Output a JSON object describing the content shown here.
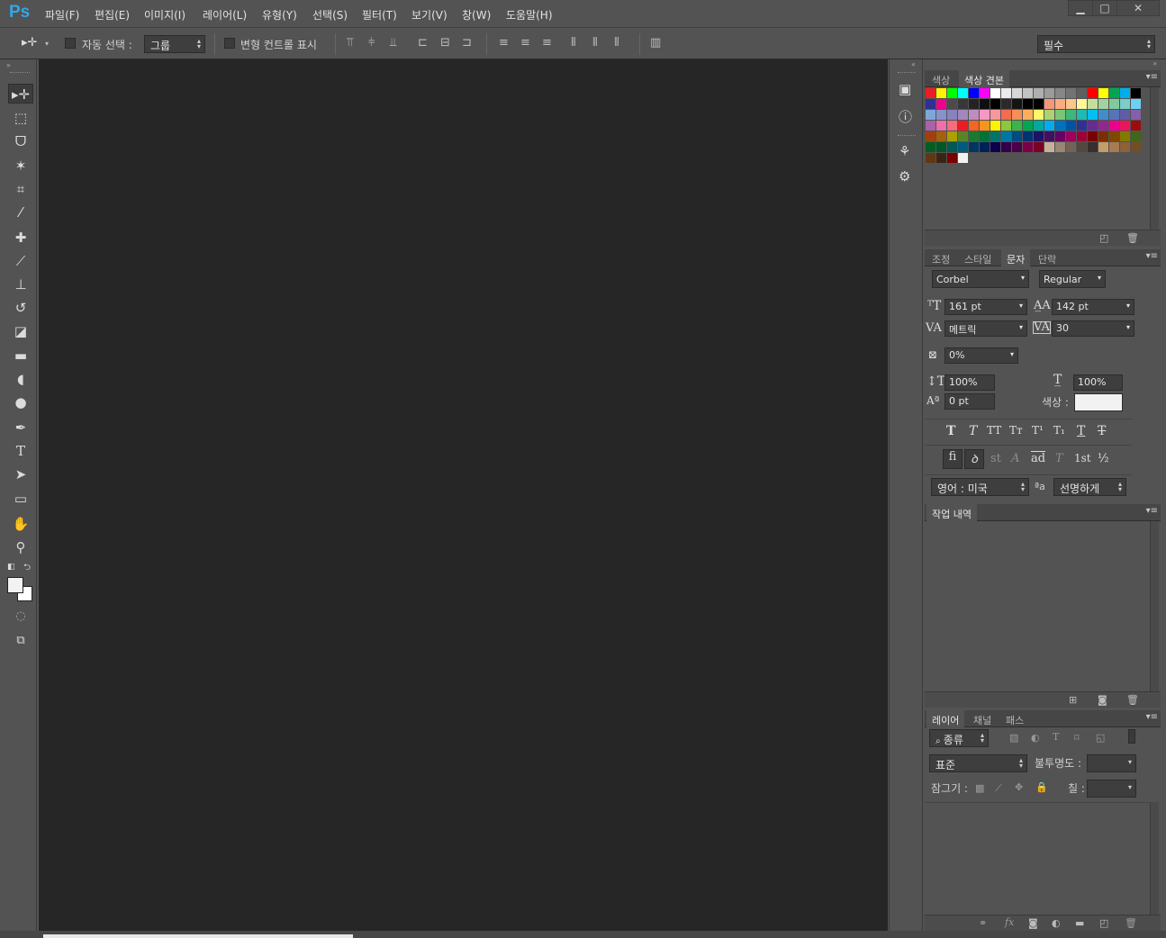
{
  "app": {
    "logo": "Ps"
  },
  "menu": [
    "파일(F)",
    "편집(E)",
    "이미지(I)",
    "레이어(L)",
    "유형(Y)",
    "선택(S)",
    "필터(T)",
    "보기(V)",
    "창(W)",
    "도움말(H)"
  ],
  "window_controls": {
    "minimize": "▁",
    "maximize": "□",
    "close": "✕"
  },
  "options_bar": {
    "auto_select_label": "자동 선택 :",
    "auto_select_value": "그룹",
    "transform_controls_label": "변형 컨트롤 표시",
    "workspace": "필수"
  },
  "swatches": {
    "tabs": [
      "색상",
      "색상 견본"
    ],
    "colors": [
      "#ec1c24",
      "#fff200",
      "#00ff00",
      "#00ffff",
      "#0000ff",
      "#ff00ff",
      "#ffffff",
      "#ebebeb",
      "#d7d7d7",
      "#c3c3c3",
      "#afafaf",
      "#9b9b9b",
      "#878787",
      "#737373",
      "#5f5f5f",
      "#ff0000",
      "#ffff00",
      "#00a651",
      "#00aeef",
      "#000000",
      "#2e3192",
      "#ec008c",
      "#4b4b4b",
      "#373737",
      "#232323",
      "#0f0f0f",
      "#000000",
      "#2a2a2a",
      "#141414",
      "#000000",
      "#000000",
      "#f7977a",
      "#f9ad81",
      "#fdc68a",
      "#fff79a",
      "#c4df9b",
      "#a3d39c",
      "#82ca9d",
      "#7bcdc8",
      "#6ecff6",
      "#7ea7d8",
      "#8493ca",
      "#8882be",
      "#a187be",
      "#bc8dbf",
      "#f49ac2",
      "#f6989d",
      "#f26c4f",
      "#f68e56",
      "#fbaf5d",
      "#fff568",
      "#acd373",
      "#7cc576",
      "#3cb878",
      "#1cbbb4",
      "#00bff3",
      "#438ccb",
      "#5574b9",
      "#605ca8",
      "#855fa8",
      "#a863a8",
      "#f06ea9",
      "#f26d7d",
      "#ed1c24",
      "#f26522",
      "#f7941d",
      "#fff200",
      "#8dc63f",
      "#39b54a",
      "#00a651",
      "#00a99d",
      "#00aeef",
      "#0072bc",
      "#0054a6",
      "#2e3192",
      "#662d91",
      "#92278f",
      "#ec008c",
      "#ed145b",
      "#9e0b0f",
      "#a0410d",
      "#a36209",
      "#aba000",
      "#598527",
      "#1a7b30",
      "#007236",
      "#00746b",
      "#0076a3",
      "#004b80",
      "#003471",
      "#1b1464",
      "#440e62",
      "#630460",
      "#9e005d",
      "#9e0039",
      "#790000",
      "#7b2e00",
      "#7d4900",
      "#827b00",
      "#406618",
      "#005e20",
      "#005826",
      "#005952",
      "#005b7f",
      "#003663",
      "#002157",
      "#0d004c",
      "#32004b",
      "#4b0049",
      "#7b0046",
      "#7a0026",
      "#c7b299",
      "#998675",
      "#736357",
      "#534741",
      "#362f2d",
      "#c69c6d",
      "#a67c52",
      "#8c6239",
      "#754c24",
      "#603913",
      "#3c2415",
      "#790000",
      "#f2f2f2"
    ]
  },
  "character": {
    "tabs": [
      "조정",
      "스타일",
      "문자",
      "단락"
    ],
    "font_family": "Corbel",
    "font_style": "Regular",
    "size": "161 pt",
    "leading": "142 pt",
    "kerning": "메트릭",
    "tracking": "30",
    "tsume": "0%",
    "vertical_scale": "100%",
    "horizontal_scale": "100%",
    "baseline_shift": "0 pt",
    "color_label": "색상 :",
    "color_value": "#f2f2f2",
    "style_buttons": [
      "T",
      "T",
      "TT",
      "Tт",
      "T¹",
      "T₁",
      "T",
      "T"
    ],
    "opentype_buttons": [
      "fi",
      "ꝺ",
      "st",
      "A",
      "ad",
      "T",
      "1st",
      "½"
    ],
    "language": "영어 : 미국",
    "aa_icon": "ªa",
    "antialias": "선명하게"
  },
  "history": {
    "tabs": [
      "작업 내역"
    ]
  },
  "layers": {
    "tabs": [
      "레이어",
      "채널",
      "패스"
    ],
    "filter_kind": "종류",
    "blend_mode": "표준",
    "opacity_label": "불투명도 :",
    "lock_label": "잠그기 :",
    "fill_label": "칠 :"
  }
}
